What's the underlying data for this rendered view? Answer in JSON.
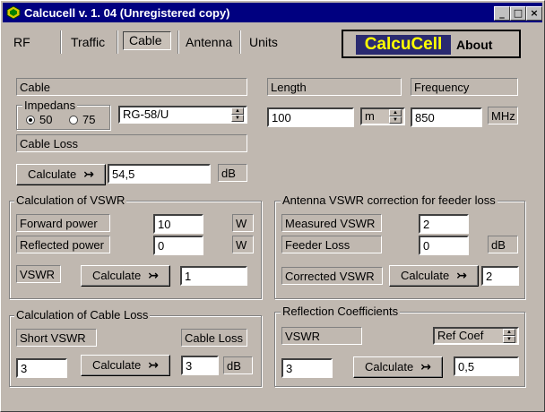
{
  "window": {
    "title": "Calcucell v. 1. 04 (Unregistered copy)",
    "minimize": "_",
    "maximize": "□",
    "close": "×"
  },
  "tabs": [
    "RF",
    "Traffic",
    "Cable",
    "Antenna",
    "Units"
  ],
  "active_tab": "Cable",
  "about": {
    "logo": "CalcuCell",
    "label": "About"
  },
  "cable": {
    "section_label": "Cable",
    "impedance_group": "Impedans",
    "radio_50": "50",
    "radio_75": "75",
    "impedance_selected": "50",
    "cable_type": "RG-58/U",
    "length_label": "Length",
    "frequency_label": "Frequency",
    "length_value": "100",
    "length_unit": "m",
    "frequency_value": "850",
    "frequency_unit": "MHz",
    "loss_label": "Cable Loss",
    "calc_label": "Calculate",
    "loss_value": "54,5",
    "loss_unit": "dB"
  },
  "vswr": {
    "title": "Calculation of VSWR",
    "forward_label": "Forward power",
    "forward_value": "10",
    "forward_unit": "W",
    "reflected_label": "Reflected power",
    "reflected_value": "0",
    "reflected_unit": "W",
    "vswr_label": "VSWR",
    "calc_label": "Calculate",
    "vswr_value": "1"
  },
  "antenna": {
    "title": "Antenna VSWR correction for feeder loss",
    "measured_label": "Measured VSWR",
    "measured_value": "2",
    "feeder_label": "Feeder Loss",
    "feeder_value": "0",
    "feeder_unit": "dB",
    "corrected_label": "Corrected VSWR",
    "calc_label": "Calculate",
    "corrected_value": "2"
  },
  "cableloss": {
    "title": "Calculation of Cable Loss",
    "short_label": "Short VSWR",
    "loss_label": "Cable Loss",
    "short_value": "3",
    "calc_label": "Calculate",
    "loss_value": "3",
    "loss_unit": "dB"
  },
  "reflection": {
    "title": "Reflection Coefficients",
    "vswr_label": "VSWR",
    "select_value": "Ref Coef",
    "vswr_value": "3",
    "calc_label": "Calculate",
    "result_value": "0,5"
  },
  "icons": {
    "app": "calcucell-app-icon",
    "arrow": "↣"
  }
}
